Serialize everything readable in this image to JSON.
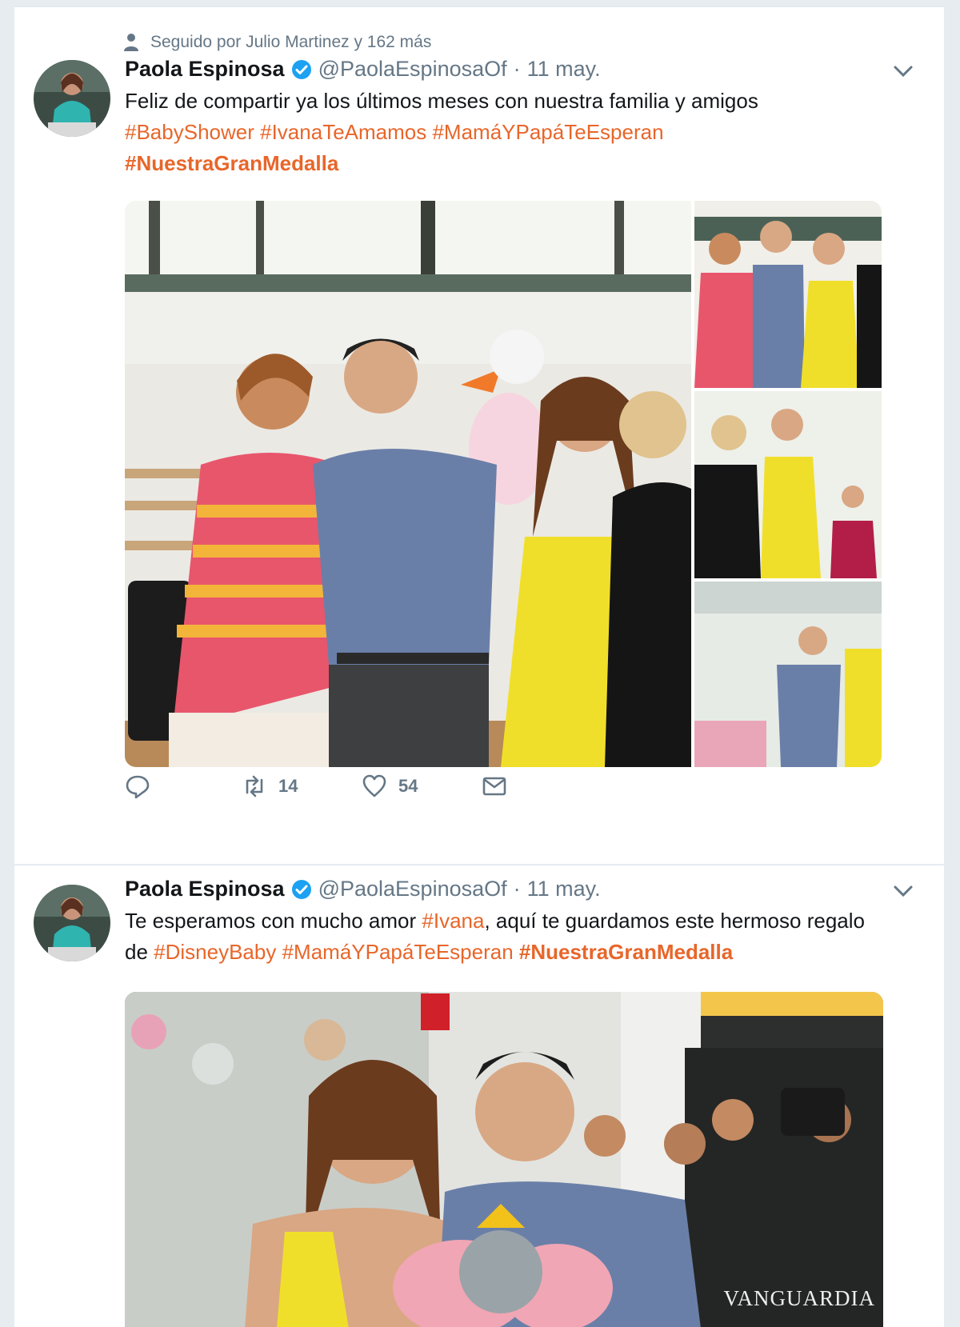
{
  "tweets": [
    {
      "social_context": "Seguido por Julio Martinez y 162 más",
      "author": {
        "name": "Paola Espinosa",
        "handle": "@PaolaEspinosaOf"
      },
      "separator": "·",
      "date": "11 may.",
      "text_plain_1": "Feliz de compartir ya los últimos meses con nuestra familia y amigos",
      "hashtags_line1": [
        "#BabyShower",
        "#IvanaTeAmamos",
        "#MamáYPapáTeEsperan"
      ],
      "hashtag_bold": "#NuestraGranMedalla",
      "reply_count": "",
      "retweet_count": "14",
      "like_count": "54"
    },
    {
      "author": {
        "name": "Paola Espinosa",
        "handle": "@PaolaEspinosaOf"
      },
      "separator": "·",
      "date": "11 may.",
      "text_part1": "Te esperamos con mucho amor ",
      "tag_ivana": "#Ivana",
      "text_part2": ", aquí te guardamos este hermoso regalo de ",
      "tag_disney": "#DisneyBaby",
      "tag_mama": "#MamáYPapáTeEsperan",
      "tag_medalla": "#NuestraGranMedalla",
      "watermark": "VANGUARDIA"
    }
  ],
  "colors": {
    "hashtag": "#e8662a",
    "meta": "#657786",
    "verified": "#1da1f2",
    "background": "#e6ecf0"
  },
  "icons": [
    "person-icon",
    "verified-badge-icon",
    "chevron-down-icon",
    "reply-icon",
    "retweet-icon",
    "heart-icon",
    "message-icon"
  ]
}
